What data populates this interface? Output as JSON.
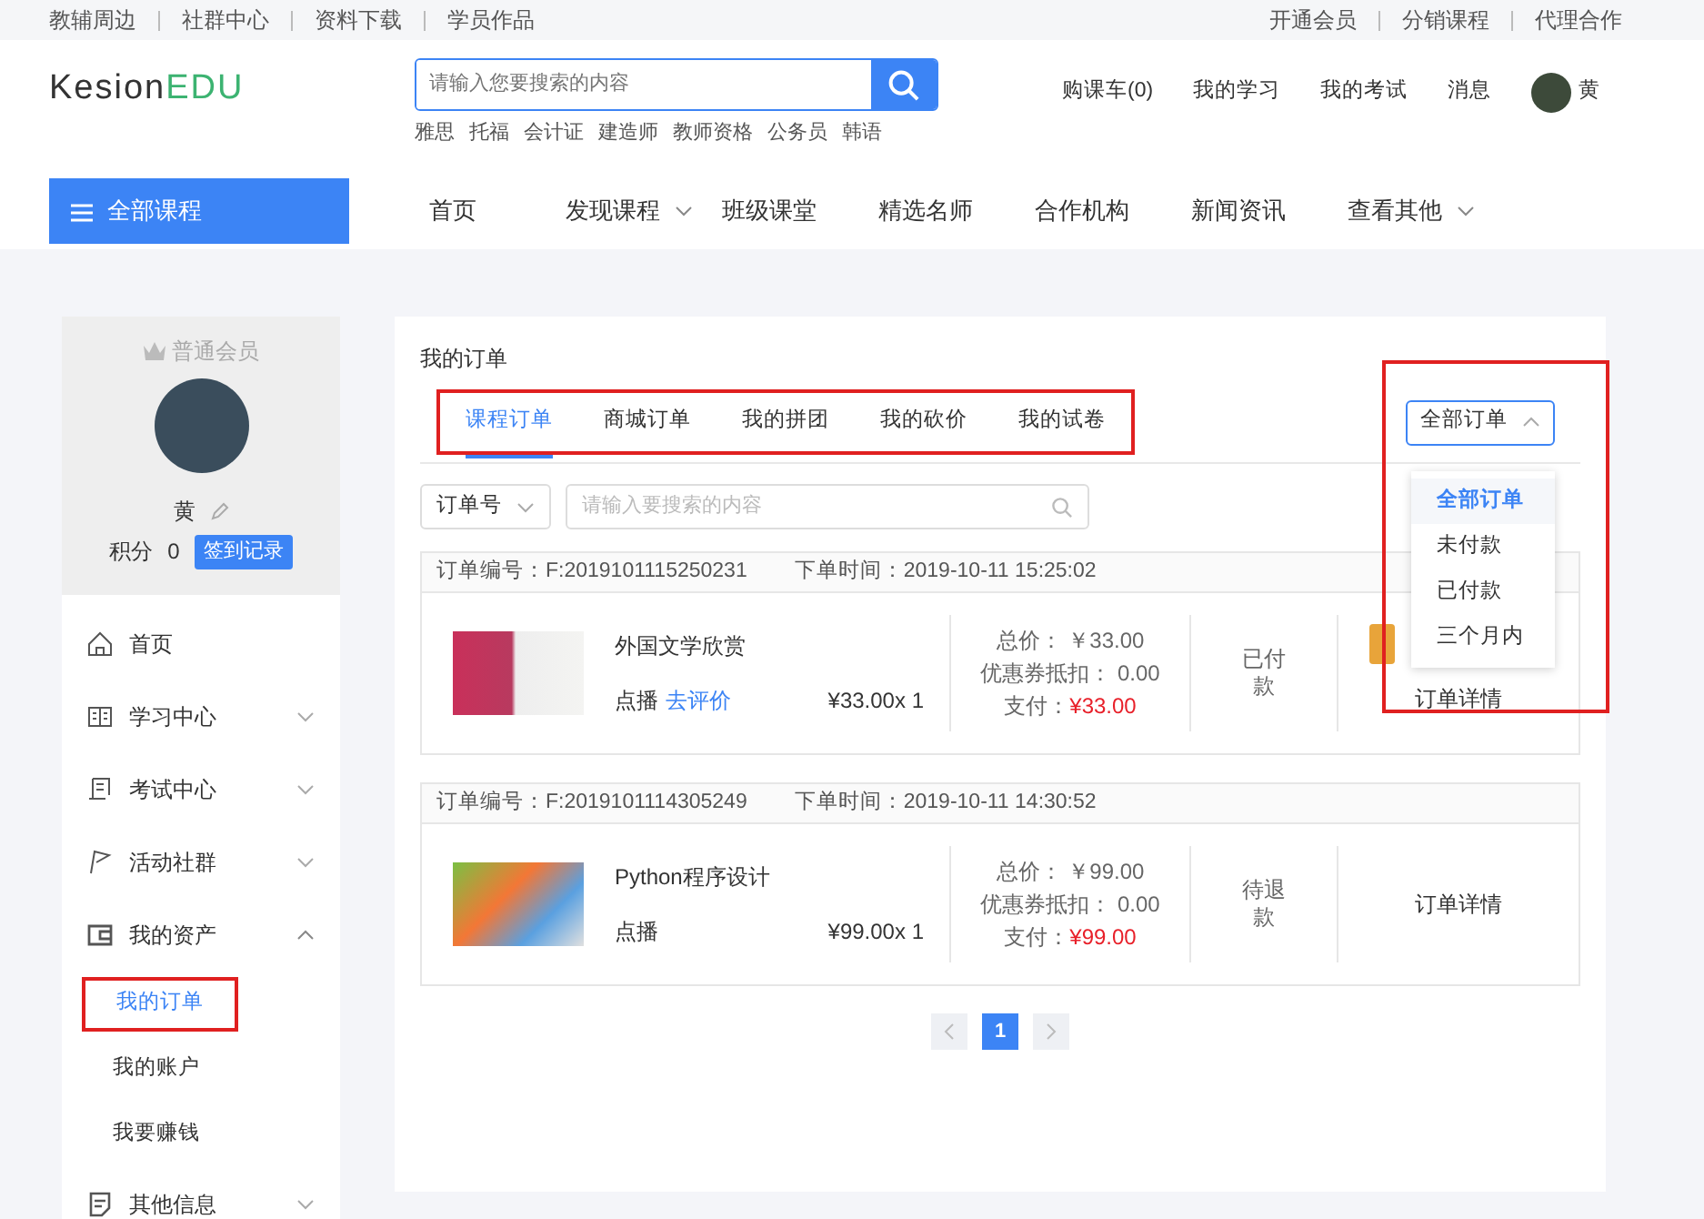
{
  "top_links_left": [
    "教辅周边",
    "社群中心",
    "资料下载",
    "学员作品"
  ],
  "top_links_right": [
    "开通会员",
    "分销课程",
    "代理合作"
  ],
  "logo": {
    "dark": "Kesion",
    "accent": "EDU"
  },
  "search": {
    "placeholder": "请输入您要搜索的内容"
  },
  "hot_tags": [
    "雅思",
    "托福",
    "会计证",
    "建造师",
    "教师资格",
    "公务员",
    "韩语"
  ],
  "header_links": [
    "购课车(0)",
    "我的学习",
    "我的考试",
    "消息"
  ],
  "user": {
    "name": "黄"
  },
  "nav": {
    "all_courses": "全部课程",
    "items": [
      {
        "label": "首页",
        "dropdown": false
      },
      {
        "label": "发现课程",
        "dropdown": true
      },
      {
        "label": "班级课堂",
        "dropdown": false
      },
      {
        "label": "精选名师",
        "dropdown": false
      },
      {
        "label": "合作机构",
        "dropdown": false
      },
      {
        "label": "新闻资讯",
        "dropdown": false
      },
      {
        "label": "查看其他",
        "dropdown": true
      }
    ]
  },
  "profile": {
    "level": "普通会员",
    "name": "黄",
    "points_label": "积分",
    "points": "0",
    "checkin": "签到记录"
  },
  "sidebar": {
    "items": [
      {
        "label": "首页",
        "kind": "home"
      },
      {
        "label": "学习中心",
        "kind": "book",
        "expanded": false
      },
      {
        "label": "考试中心",
        "kind": "scroll",
        "expanded": false
      },
      {
        "label": "活动社群",
        "kind": "flag",
        "expanded": false
      },
      {
        "label": "我的资产",
        "kind": "wallet",
        "expanded": true,
        "children": [
          {
            "label": "我的订单",
            "selected": true,
            "highlighted": true
          },
          {
            "label": "我的账户",
            "selected": false,
            "highlighted": false
          },
          {
            "label": "我要赚钱",
            "selected": false,
            "highlighted": false
          }
        ]
      },
      {
        "label": "其他信息",
        "kind": "note",
        "expanded": false
      }
    ]
  },
  "page_title": "我的订单",
  "tabs_highlighted": true,
  "tabs": [
    {
      "label": "课程订单",
      "selected": true
    },
    {
      "label": "商城订单",
      "selected": false
    },
    {
      "label": "我的拼团",
      "selected": false
    },
    {
      "label": "我的砍价",
      "selected": false
    },
    {
      "label": "我的试卷",
      "selected": false
    }
  ],
  "filter": {
    "label": "全部订单",
    "open": true,
    "highlighted": true,
    "options": [
      {
        "label": "全部订单",
        "selected": true
      },
      {
        "label": "未付款",
        "selected": false
      },
      {
        "label": "已付款",
        "selected": false
      },
      {
        "label": "三个月内",
        "selected": false
      }
    ]
  },
  "order_search": {
    "type": "订单号",
    "placeholder": "请输入要搜索的内容"
  },
  "orders": [
    {
      "number": "订单编号：F:2019101115250231",
      "time": "下单时间：2019-10-11 15:25:02",
      "title": "外国文学欣赏",
      "type": "点播",
      "review": "去评价",
      "unit": "¥33.00x 1",
      "total": "总价： ￥33.00",
      "coupon": "优惠券抵扣： 0.00",
      "paid_label": "支付：",
      "paid": "¥33.00",
      "status": "已付款",
      "action": "订单详情",
      "pay_button": true
    },
    {
      "number": "订单编号：F:2019101114305249",
      "time": "下单时间：2019-10-11 14:30:52",
      "title": "Python程序设计",
      "type": "点播",
      "unit": "¥99.00x 1",
      "total": "总价： ￥99.00",
      "coupon": "优惠券抵扣： 0.00",
      "paid_label": "支付：",
      "paid": "¥99.00",
      "status": "待退款",
      "action": "订单详情",
      "pay_button": false
    }
  ],
  "pagination": {
    "pages": [
      {
        "label": "1",
        "selected": true
      }
    ]
  }
}
